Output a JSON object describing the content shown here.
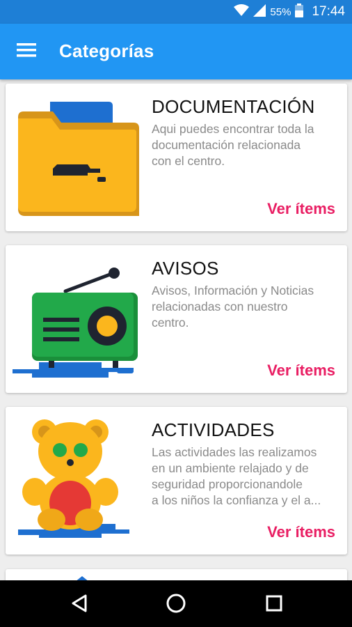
{
  "status_bar": {
    "battery_percent": "55%",
    "time": "17:44",
    "icons": [
      "wifi-icon",
      "signal-icon",
      "battery-icon"
    ]
  },
  "app_bar": {
    "title": "Categorías",
    "menu_icon": "hamburger-menu-icon"
  },
  "categories": [
    {
      "title": "DOCUMENTACIÓN",
      "description": "Aqui puedes encontrar toda la\ndocumentación relacionada\ncon el centro.",
      "link": "Ver ítems",
      "illustration": "folder-icon"
    },
    {
      "title": "AVISOS",
      "description": "Avisos, Información y Noticias\nrelacionadas con nuestro\ncentro.",
      "link": "Ver ítems",
      "illustration": "radio-icon"
    },
    {
      "title": "ACTIVIDADES",
      "description": "Las actividades las realizamos\nen un ambiente relajado y de\nseguridad proporcionandole\na los niños la confianza y el a...",
      "link": "Ver ítems",
      "illustration": "teddy-bear-icon"
    }
  ],
  "navigation": {
    "back": "back-icon",
    "home": "home-icon",
    "recents": "recents-icon"
  },
  "colors": {
    "status_bar": "#1e7fd6",
    "app_bar": "#2196f3",
    "accent": "#e91e63",
    "background": "#eeeeee"
  }
}
